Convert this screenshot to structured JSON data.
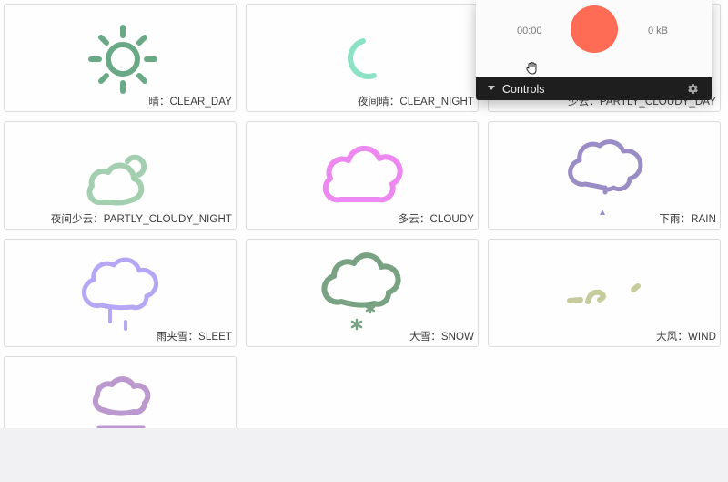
{
  "recorder": {
    "time": "00:00",
    "size": "0 kB",
    "controls_label": "Controls",
    "record_color": "#fe6c56"
  },
  "cards": [
    {
      "label": "晴：CLEAR_DAY",
      "icon": "sun-icon"
    },
    {
      "label": "夜间晴：CLEAR_NIGHT",
      "icon": "moon-icon"
    },
    {
      "label": "少云：PARTLY_CLOUDY_DAY",
      "icon": "partly-cloudy-day-icon"
    },
    {
      "label": "夜间少云：PARTLY_CLOUDY_NIGHT",
      "icon": "partly-cloudy-night-icon"
    },
    {
      "label": "多云：CLOUDY",
      "icon": "cloud-icon"
    },
    {
      "label": "下雨：RAIN",
      "icon": "rain-icon"
    },
    {
      "label": "雨夹雪：SLEET",
      "icon": "sleet-icon"
    },
    {
      "label": "大雪：SNOW",
      "icon": "snow-icon"
    },
    {
      "label": "大风：WIND",
      "icon": "wind-icon"
    },
    {
      "label": "",
      "icon": "fog-icon"
    }
  ],
  "colors": {
    "sun": "#6aa986",
    "moon": "#8de2c6",
    "partly_cloudy_night": "#a3cfb0",
    "cloudy": "#ec88ef",
    "rain": "#9a8cc4",
    "sleet": "#b6a7f5",
    "snow": "#78a282",
    "wind": "#c6cb9b",
    "fog": "#bb99cf"
  }
}
